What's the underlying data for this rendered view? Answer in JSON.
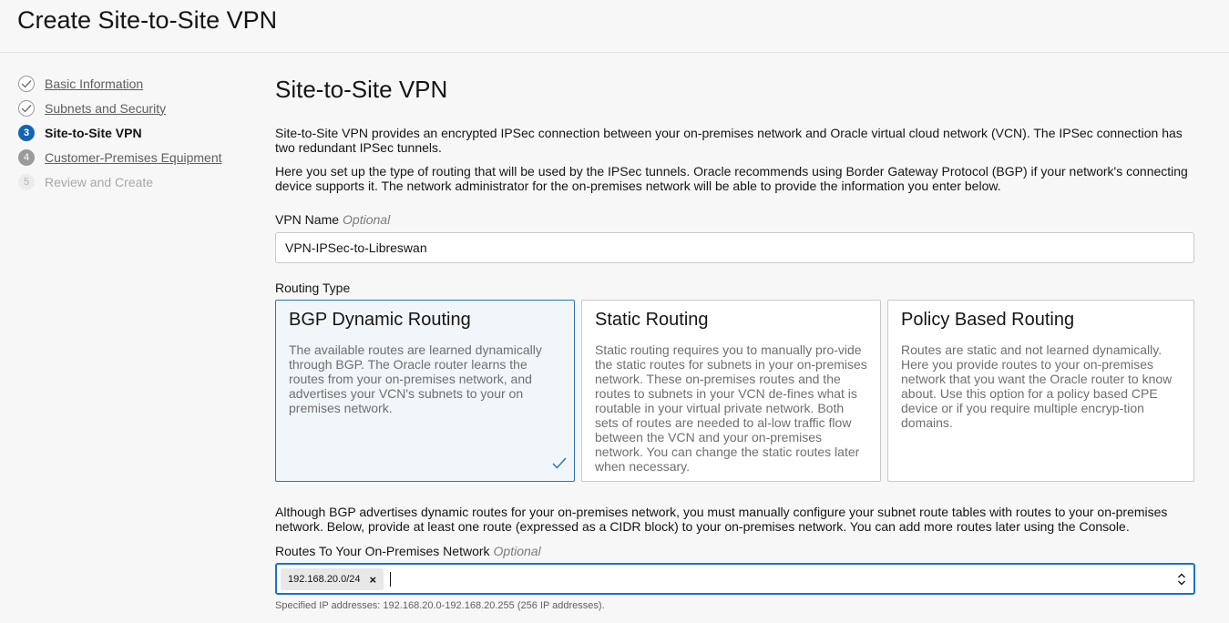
{
  "page_title": "Create Site-to-Site VPN",
  "steps": [
    {
      "num": "",
      "label": "Basic Information"
    },
    {
      "num": "",
      "label": "Subnets and Security"
    },
    {
      "num": "3",
      "label": "Site-to-Site VPN"
    },
    {
      "num": "4",
      "label": "Customer-Premises Equipment"
    },
    {
      "num": "5",
      "label": "Review and Create"
    }
  ],
  "section": {
    "title": "Site-to-Site VPN",
    "intro1": "Site-to-Site VPN provides an encrypted IPSec connection between your on-premises network and Oracle virtual cloud network (VCN). The IPSec connection has two redundant IPSec tunnels.",
    "intro2": "Here you set up the type of routing that will be used by the IPSec tunnels. Oracle recommends using Border Gateway Protocol (BGP) if your network's connecting device supports it. The network administrator for the on-premises network will be able to provide the information you enter below."
  },
  "vpn_name": {
    "label": "VPN Name",
    "optional": "Optional",
    "value": "VPN-IPSec-to-Libreswan"
  },
  "routing": {
    "label": "Routing Type",
    "options": [
      {
        "title": "BGP Dynamic Routing",
        "desc": "The available routes are learned dynamically through BGP. The Oracle router learns the routes from your on-premises network, and advertises your VCN's subnets to your on premises network."
      },
      {
        "title": "Static Routing",
        "desc": "Static routing requires you to manually pro-vide the static routes for subnets in your on-premises network. These on-premises routes and the routes to subnets in your VCN de-fines what is routable in your virtual private network. Both sets of routes are needed to al-low traffic flow between the VCN and your on-premises network. You can change the static routes later when necessary."
      },
      {
        "title": "Policy Based Routing",
        "desc": "Routes are static and not learned dynamically. Here you provide routes to your on-premises network that you want the Oracle router to know about. Use this option for a policy based CPE device or if you require multiple encryp-tion domains."
      }
    ],
    "selected": "BGP Dynamic Routing"
  },
  "bgp_note": "Although BGP advertises dynamic routes for your on-premises network, you must manually configure your subnet route tables with routes to your on-premises network. Below, provide at least one route (expressed as a CIDR block) to your on-premises network. You can add more routes later using the Console.",
  "routes": {
    "label": "Routes To Your On-Premises Network",
    "optional": "Optional",
    "chips": [
      "192.168.20.0/24"
    ],
    "remove_glyph": "×",
    "hint": "Specified IP addresses: 192.168.20.0-192.168.20.255 (256 IP addresses)."
  },
  "colors": {
    "accent": "#1464b4",
    "selected_border": "#2f74b6",
    "focus_border": "#1a73c7"
  }
}
